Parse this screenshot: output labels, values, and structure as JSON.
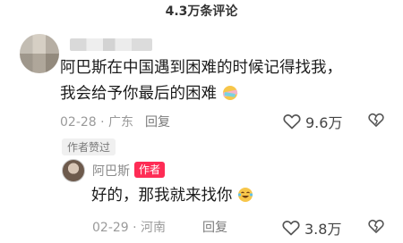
{
  "header": {
    "title": "4.3万条评论"
  },
  "comment": {
    "text_line1": "阿巴斯在中国遇到困难的时候记得找我，",
    "text_line2": "我会给予你最后的困难",
    "date": "02-28",
    "location": "广东",
    "reply_label": "回复",
    "likes": "9.6万",
    "author_liked_label": "作者赞过"
  },
  "reply": {
    "author_name": "阿巴斯",
    "author_tag": "作者",
    "text": "好的，那我就来找你",
    "date": "02-29",
    "location": "河南",
    "reply_label": "回复",
    "likes": "3.8万"
  },
  "icons": {
    "emoji_1": "face-with-bandage-emoji",
    "emoji_2": "crying-laughing-emoji",
    "like": "heart-outline-icon",
    "dislike": "broken-heart-icon"
  },
  "colors": {
    "author_tag": "#fe2c55"
  }
}
